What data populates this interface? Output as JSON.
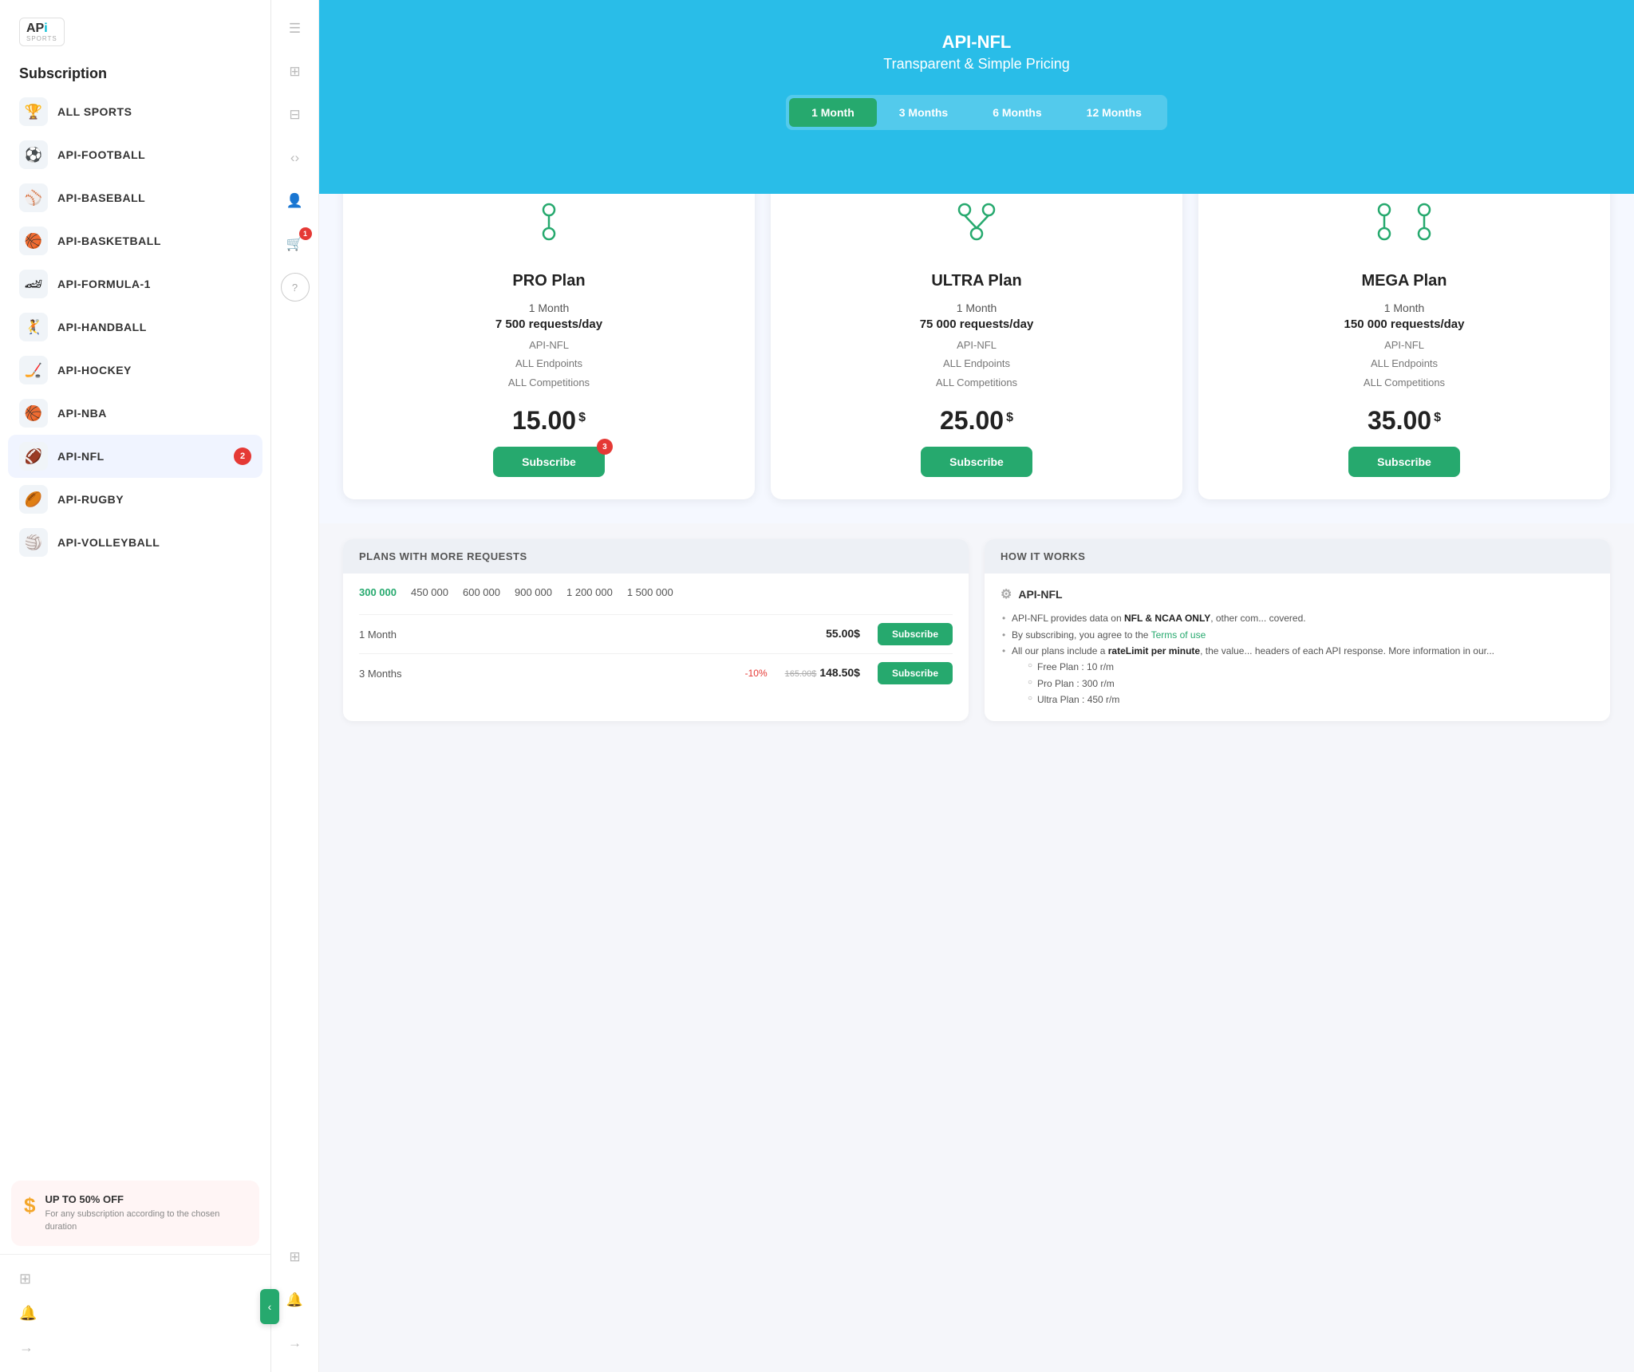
{
  "sidebar": {
    "title": "Subscription",
    "logo": {
      "api": "AP",
      "i": "i",
      "sports": "SPORTS"
    },
    "sports": [
      {
        "id": "all-sports",
        "name": "ALL SPORTS",
        "icon": "🏆",
        "badge": null
      },
      {
        "id": "football",
        "name": "API-FOOTBALL",
        "icon": "⚽",
        "badge": null
      },
      {
        "id": "baseball",
        "name": "API-BASEBALL",
        "icon": "⚾",
        "badge": null
      },
      {
        "id": "basketball",
        "name": "API-BASKETBALL",
        "icon": "🏀",
        "badge": null
      },
      {
        "id": "formula1",
        "name": "API-FORMULA-1",
        "icon": "🏎️",
        "badge": null
      },
      {
        "id": "handball",
        "name": "API-HANDBALL",
        "icon": "🤾",
        "badge": null
      },
      {
        "id": "hockey",
        "name": "API-HOCKEY",
        "icon": "🏒",
        "badge": null
      },
      {
        "id": "nba",
        "name": "API-NBA",
        "icon": "🏀",
        "badge": null
      },
      {
        "id": "nfl",
        "name": "API-NFL",
        "icon": "🏈",
        "badge": 2
      },
      {
        "id": "rugby",
        "name": "API-RUGBY",
        "icon": "🏉",
        "badge": null
      },
      {
        "id": "volleyball",
        "name": "API-VOLLEYBALL",
        "icon": "🏐",
        "badge": null
      }
    ],
    "promo": {
      "title": "UP TO 50% OFF",
      "desc": "For any subscription according to the chosen duration",
      "icon": "S"
    }
  },
  "icon_strip": {
    "icons": [
      {
        "id": "menu-icon",
        "symbol": "☰"
      },
      {
        "id": "grid-icon",
        "symbol": "⊞"
      },
      {
        "id": "layers-icon",
        "symbol": "⊟"
      },
      {
        "id": "code-icon",
        "symbol": "‹›"
      },
      {
        "id": "user-icon",
        "symbol": "👤"
      },
      {
        "id": "cart-icon",
        "symbol": "🛒",
        "badge": 1
      },
      {
        "id": "help-icon",
        "symbol": "?"
      }
    ],
    "bottom_icons": [
      {
        "id": "grid-bottom-icon",
        "symbol": "⊞"
      },
      {
        "id": "bell-icon",
        "symbol": "🔔"
      },
      {
        "id": "logout-icon",
        "symbol": "→"
      }
    ]
  },
  "hero": {
    "title": "API-NFL",
    "subtitle": "Transparent & Simple Pricing",
    "tabs": [
      {
        "id": "1month",
        "label": "1 Month",
        "active": true
      },
      {
        "id": "3months",
        "label": "3 Months",
        "active": false
      },
      {
        "id": "6months",
        "label": "6 Months",
        "active": false
      },
      {
        "id": "12months",
        "label": "12 Months",
        "active": false
      }
    ]
  },
  "plans": [
    {
      "id": "pro",
      "name": "PRO Plan",
      "duration": "1 Month",
      "requests": "7 500 requests/day",
      "features": [
        "API-NFL",
        "ALL Endpoints",
        "ALL Competitions"
      ],
      "price": "15.00",
      "currency": "$",
      "btn_label": "Subscribe",
      "btn_badge": 3
    },
    {
      "id": "ultra",
      "name": "ULTRA Plan",
      "duration": "1 Month",
      "requests": "75 000 requests/day",
      "features": [
        "API-NFL",
        "ALL Endpoints",
        "ALL Competitions"
      ],
      "price": "25.00",
      "currency": "$",
      "btn_label": "Subscribe",
      "btn_badge": null
    },
    {
      "id": "mega",
      "name": "MEGA Plan",
      "duration": "1 Month",
      "requests": "150 000 requests/day",
      "features": [
        "API-NFL",
        "ALL Endpoints",
        "ALL Competitions"
      ],
      "price": "35.00",
      "currency": "$",
      "btn_label": "Subscribe",
      "btn_badge": null
    }
  ],
  "plans_more": {
    "section_title": "PLANS WITH MORE REQUESTS",
    "amounts": [
      "300 000",
      "450 000",
      "600 000",
      "900 000",
      "1 200 000",
      "1 500 000"
    ],
    "rows": [
      {
        "label": "1 Month",
        "discount": "",
        "old_price": "",
        "price": "55.00$",
        "btn_label": "Subscribe"
      },
      {
        "label": "3 Months",
        "discount": "-10%",
        "old_price": "165.00$",
        "price": "148.50$",
        "btn_label": "Subscribe"
      }
    ]
  },
  "how_it_works": {
    "section_title": "HOW IT WORKS",
    "api_name": "API-NFL",
    "items": [
      "API-NFL provides data on <strong>NFL & NCAA ONLY</strong>, other com... covered.",
      "By subscribing, you agree to the <a>Terms of use</a>",
      "All our plans include a <strong>rateLimit per minute</strong>, the value... headers of each API response. More information in our..."
    ],
    "sub_items": [
      "Free Plan : 10 r/m",
      "Pro Plan : 300 r/m",
      "Ultra Plan : 450 r/m"
    ]
  },
  "colors": {
    "accent_green": "#26a96e",
    "accent_blue": "#29bde8",
    "danger": "#e53935",
    "text_dark": "#222",
    "text_muted": "#777"
  }
}
